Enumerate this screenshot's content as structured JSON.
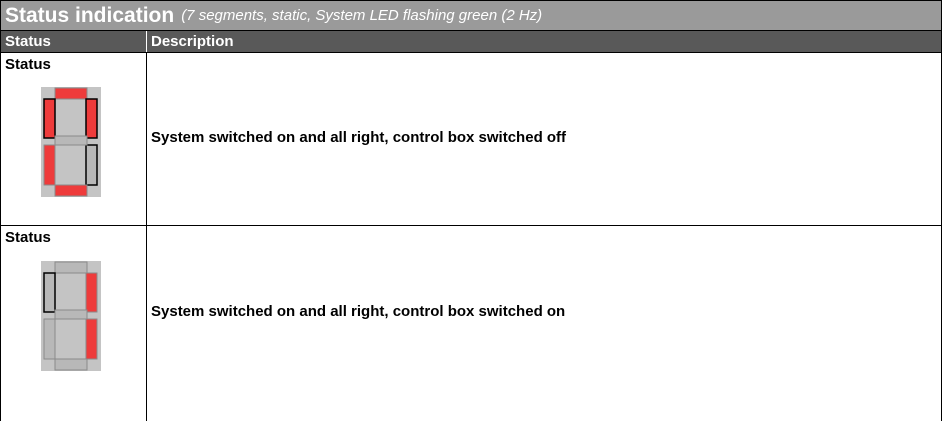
{
  "title": {
    "main": "Status indication",
    "subtitle": "(7 segments, static, System LED flashing green (2 Hz)"
  },
  "columns": {
    "status": "Status",
    "description": "Description"
  },
  "rows": [
    {
      "status_label": "Status",
      "description": "System switched on and all right, control box switched off",
      "segments_lit": [
        "a",
        "b",
        "d",
        "e",
        "f"
      ],
      "segments_outlined": [
        "b",
        "c",
        "f"
      ]
    },
    {
      "status_label": "Status",
      "description": "System switched on and all right, control box switched on",
      "segments_lit": [
        "b",
        "c"
      ],
      "segments_outlined": [
        "f"
      ]
    }
  ],
  "colors": {
    "segment_on": "#ee3b3b",
    "segment_off": "#b8b8b8",
    "display_bg": "#c4c4c4"
  }
}
